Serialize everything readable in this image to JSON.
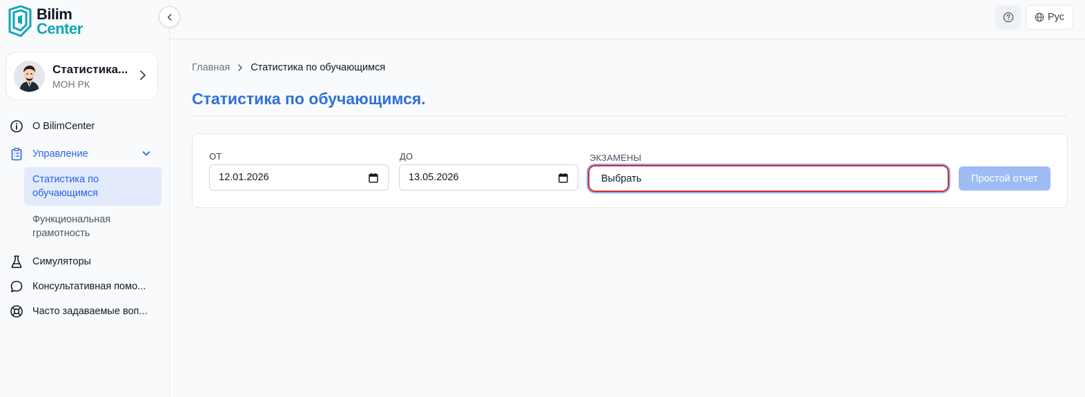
{
  "brand": {
    "line1": "Bilim",
    "line2": "Center"
  },
  "profile": {
    "name": "Статистика...",
    "org": "МОН РК"
  },
  "sidebar": {
    "items": [
      {
        "label": "О BilimCenter",
        "icon": "info-icon"
      },
      {
        "label": "Управление",
        "icon": "clipboard-icon"
      },
      {
        "label": "Симуляторы",
        "icon": "flask-icon"
      },
      {
        "label": "Консультативная помо...",
        "icon": "chat-bubble-icon"
      },
      {
        "label": "Часто задаваемые воп...",
        "icon": "lifebuoy-icon"
      }
    ],
    "sub_items": [
      {
        "label": "Статистика по обучающимся",
        "active": true
      },
      {
        "label": "Функциональная грамотность",
        "active": false
      }
    ]
  },
  "header": {
    "lang_label": "Рус"
  },
  "breadcrumb": {
    "home": "Главная",
    "current": "Статистика по обучающимся"
  },
  "page": {
    "title": "Статистика по обучающимся."
  },
  "filters": {
    "from_label": "От",
    "from_value": "12.01.2026",
    "to_label": "До",
    "to_value": "13.05.2026",
    "exams_label": "Экзамены",
    "exams_value": "Выбрать",
    "submit_label": "Простой отчет"
  },
  "colors": {
    "accent": "#2563eb",
    "title": "#2f6fdc",
    "brand_teal": "#0ea5b7",
    "button_disabled": "#9dbcf3",
    "focus_border": "#d9252a"
  }
}
